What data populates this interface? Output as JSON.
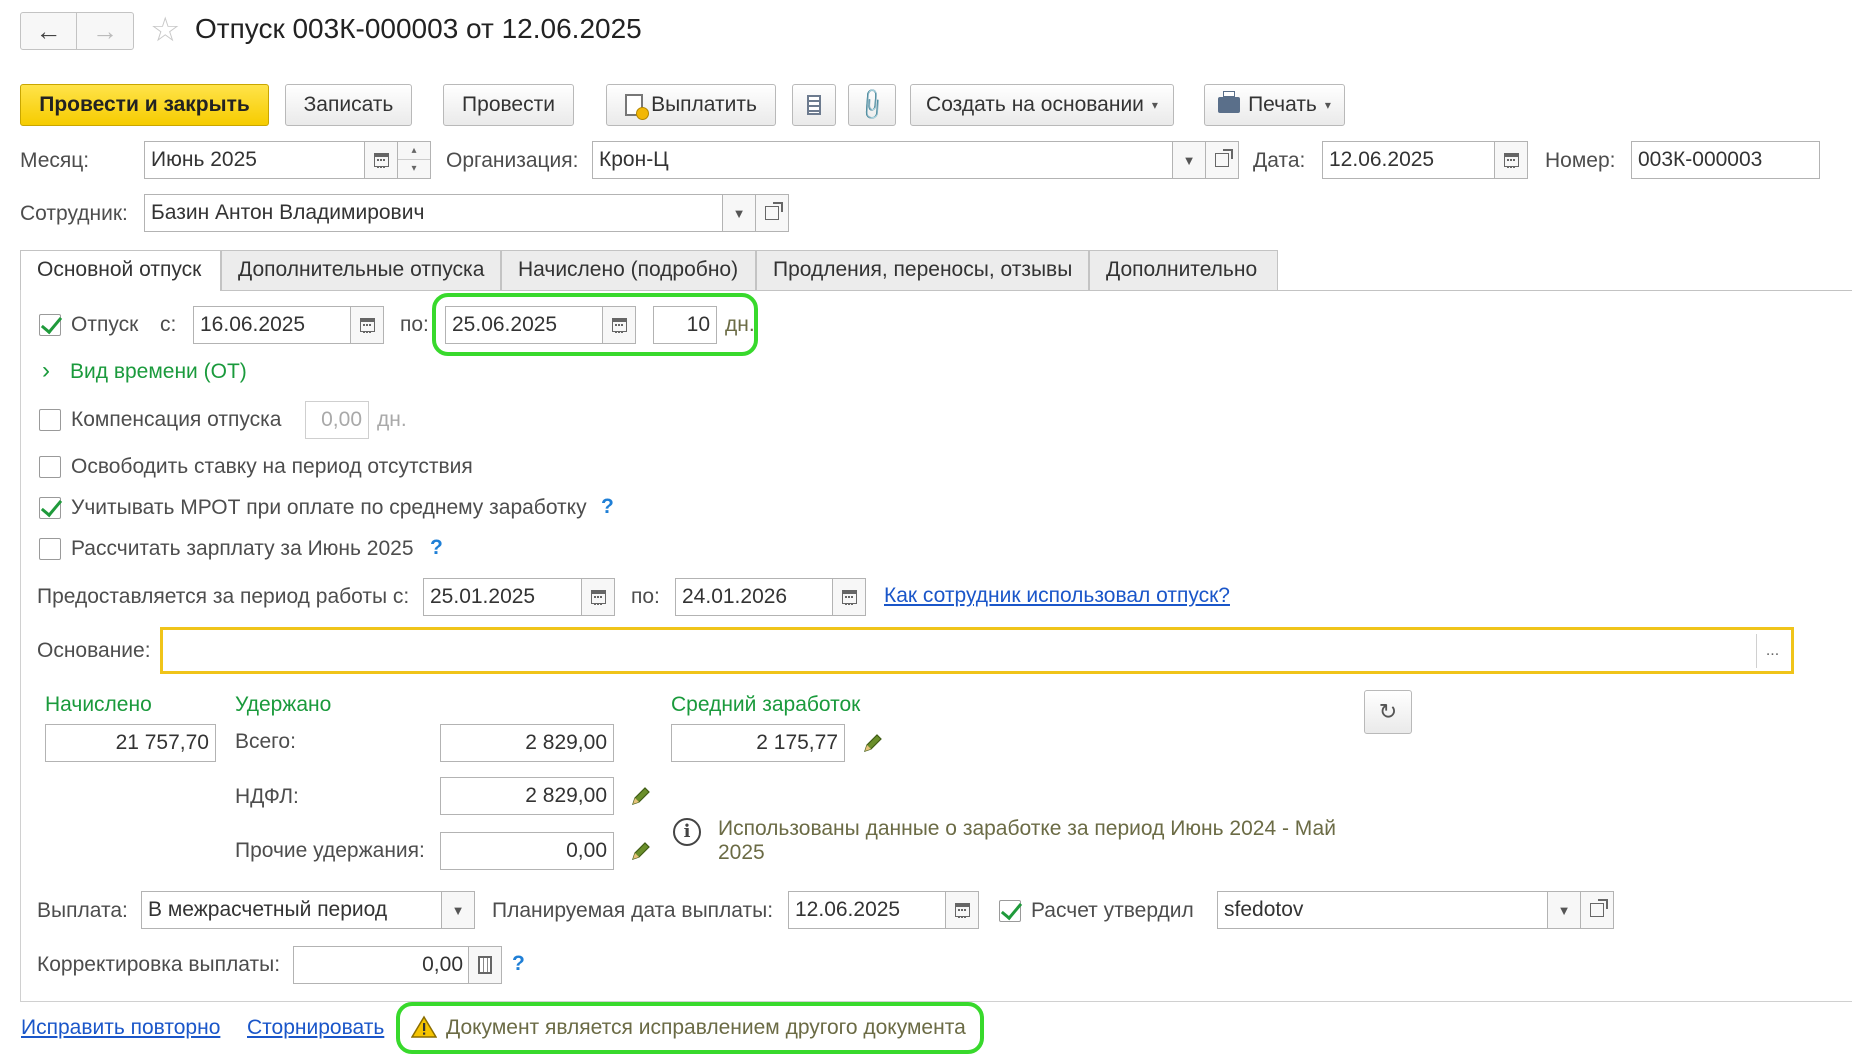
{
  "window": {
    "title": "Отпуск 003К-000003 от 12.06.2025"
  },
  "toolbar": {
    "post_close": "Провести и закрыть",
    "save": "Записать",
    "post": "Провести",
    "pay": "Выплатить",
    "create_based": "Создать на основании",
    "print": "Печать"
  },
  "header": {
    "month_label": "Месяц:",
    "month_value": "Июнь 2025",
    "org_label": "Организация:",
    "org_value": "Крон-Ц",
    "date_label": "Дата:",
    "date_value": "12.06.2025",
    "number_label": "Номер:",
    "number_value": "003К-000003",
    "employee_label": "Сотрудник:",
    "employee_value": "Базин Антон Владимирович"
  },
  "tabs": [
    "Основной отпуск",
    "Дополнительные отпуска",
    "Начислено (подробно)",
    "Продления, переносы, отзывы",
    "Дополнительно"
  ],
  "vacation": {
    "label": "Отпуск",
    "from_label": "с:",
    "from_value": "16.06.2025",
    "to_label": "по:",
    "to_value": "25.06.2025",
    "days_value": "10",
    "days_unit": "дн.",
    "time_type": "Вид времени (ОТ)",
    "compensation_label": "Компенсация отпуска",
    "compensation_value": "0,00",
    "compensation_unit": "дн.",
    "free_rate_label": "Освободить ставку на период отсутствия",
    "mrot_label": "Учитывать МРОТ при оплате по среднему заработку",
    "calc_salary_label": "Рассчитать зарплату за Июнь 2025",
    "period_label": "Предоставляется за период работы с:",
    "period_from": "25.01.2025",
    "period_to_label": "по:",
    "period_to": "24.01.2026",
    "usage_link": "Как сотрудник использовал отпуск?",
    "basis_label": "Основание:",
    "basis_value": ""
  },
  "amounts": {
    "accrued_title": "Начислено",
    "accrued_value": "21 757,70",
    "withheld_title": "Удержано",
    "total_label": "Всего:",
    "total_value": "2 829,00",
    "ndfl_label": "НДФЛ:",
    "ndfl_value": "2 829,00",
    "other_label": "Прочие удержания:",
    "other_value": "0,00",
    "avg_title": "Средний заработок",
    "avg_value": "2 175,77",
    "info_line1": "Использованы данные о заработке за период Июнь 2024 - Май",
    "info_line2": "2025"
  },
  "payment": {
    "label": "Выплата:",
    "value": "В межрасчетный период",
    "planned_label": "Планируемая дата выплаты:",
    "planned_value": "12.06.2025",
    "approved_label": "Расчет утвердил",
    "approved_value": "sfedotov",
    "correction_label": "Корректировка выплаты:",
    "correction_value": "0,00"
  },
  "footer": {
    "fix_again": "Исправить повторно",
    "reverse": "Сторнировать",
    "warning": "Документ является исправлением другого документа"
  },
  "colors": {
    "primary_button": "#f6cc00",
    "section_title": "#1a9a3c",
    "highlight": "#38d92c",
    "basis_border": "#f0c419",
    "link": "#1a56c9"
  }
}
